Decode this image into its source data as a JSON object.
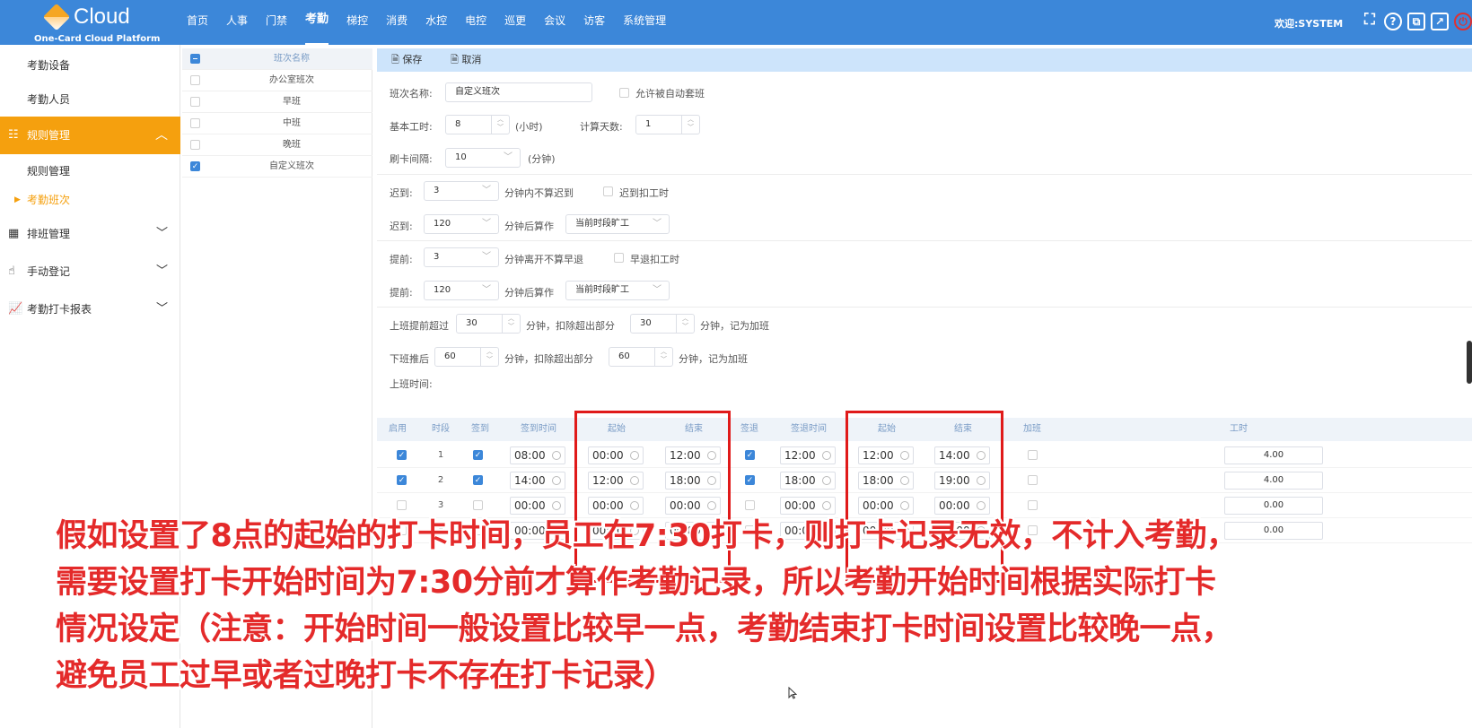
{
  "header": {
    "brand": "Cloud",
    "brand_sub": "One-Card Cloud Platform",
    "nav": [
      "首页",
      "人事",
      "门禁",
      "考勤",
      "梯控",
      "消费",
      "水控",
      "电控",
      "巡更",
      "会议",
      "访客",
      "系统管理"
    ],
    "active_nav": "考勤",
    "welcome": "欢迎:SYSTEM"
  },
  "sidebar": {
    "items": [
      {
        "label": "考勤设备"
      },
      {
        "label": "考勤人员"
      },
      {
        "label": "规则管理"
      },
      {
        "label": "规则管理"
      },
      {
        "label": "考勤班次"
      },
      {
        "label": "排班管理"
      },
      {
        "label": "手动登记"
      },
      {
        "label": "考勤打卡报表"
      }
    ]
  },
  "shift_list": {
    "header": "班次名称",
    "rows": [
      "办公室班次",
      "早班",
      "中班",
      "晚班",
      "自定义班次"
    ]
  },
  "toolbar": {
    "save": "保存",
    "cancel": "取消"
  },
  "form": {
    "shift_name_label": "班次名称:",
    "shift_name_value": "自定义班次",
    "auto_shift_label": "允许被自动套班",
    "base_hours_label": "基本工时:",
    "base_hours_value": "8",
    "base_hours_unit": "(小时)",
    "calc_days_label": "计算天数:",
    "calc_days_value": "1",
    "swipe_interval_label": "刷卡间隔:",
    "swipe_interval_value": "10",
    "swipe_interval_unit": "(分钟)",
    "late1_label": "迟到:",
    "late1_value": "3",
    "late1_text": "分钟内不算迟到",
    "late_deduct_label": "迟到扣工时",
    "late2_label": "迟到:",
    "late2_value": "120",
    "late2_text": "分钟后算作",
    "late2_select": "当前时段旷工",
    "early1_label": "提前:",
    "early1_value": "3",
    "early1_text": "分钟离开不算早退",
    "early_deduct_label": "早退扣工时",
    "early2_label": "提前:",
    "early2_value": "120",
    "early2_text": "分钟后算作",
    "early2_select": "当前时段旷工",
    "ot_before_label": "上班提前超过",
    "ot_before_value": "30",
    "ot_before_text": "分钟，扣除超出部分",
    "ot_before_value2": "30",
    "ot_before_text2": "分钟，记为加班",
    "ot_after_label": "下班推后",
    "ot_after_value": "60",
    "ot_after_text": "分钟，扣除超出部分",
    "ot_after_value2": "60",
    "ot_after_text2": "分钟，记为加班",
    "worktime_label": "上班时间:"
  },
  "table": {
    "headers": [
      "启用",
      "时段",
      "签到",
      "签到时间",
      "起始",
      "结束",
      "签退",
      "签退时间",
      "起始",
      "结束",
      "加班",
      "工时"
    ],
    "rows": [
      {
        "period": "1",
        "in_time": "08:00",
        "in_start": "00:00",
        "in_end": "12:00",
        "out_time": "12:00",
        "out_start": "12:00",
        "out_end": "14:00",
        "hours": "4.00"
      },
      {
        "period": "2",
        "in_time": "14:00",
        "in_start": "12:00",
        "in_end": "18:00",
        "out_time": "18:00",
        "out_start": "18:00",
        "out_end": "19:00",
        "hours": "4.00"
      },
      {
        "period": "3",
        "in_time": "00:00",
        "in_start": "00:00",
        "in_end": "00:00",
        "out_time": "00:00",
        "out_start": "00:00",
        "out_end": "00:00",
        "hours": "0.00"
      },
      {
        "period": "4",
        "in_time": "00:00",
        "in_start": "00:00",
        "in_end": "00:00",
        "out_time": "00:00",
        "out_start": "00:00",
        "out_end": "00:00",
        "hours": "0.00"
      }
    ]
  },
  "overlay": {
    "lines": [
      "假如设置了8点的起始的打卡时间，员工在7:30打卡，则打卡记录无效，不计入考勤，",
      "需要设置打卡开始时间为7:30分前才算作考勤记录，所以考勤开始时间根据实际打卡",
      "情况设定（注意：开始时间一般设置比较早一点，考勤结束打卡时间设置比较晚一点，",
      "避免员工过早或者过晚打卡不存在打卡记录）"
    ]
  },
  "colors": {
    "header": "#3c87d9",
    "accent": "#f5a00e",
    "annotation": "#e42a2a"
  },
  "icons": [
    "fullscreen-icon",
    "help-icon",
    "copy-icon",
    "external-link-icon",
    "power-icon",
    "save-icon",
    "cancel-icon",
    "rules-icon",
    "schedule-icon",
    "hand-icon",
    "report-icon",
    "chevron-down-icon",
    "chevron-up-icon",
    "clock-icon"
  ]
}
